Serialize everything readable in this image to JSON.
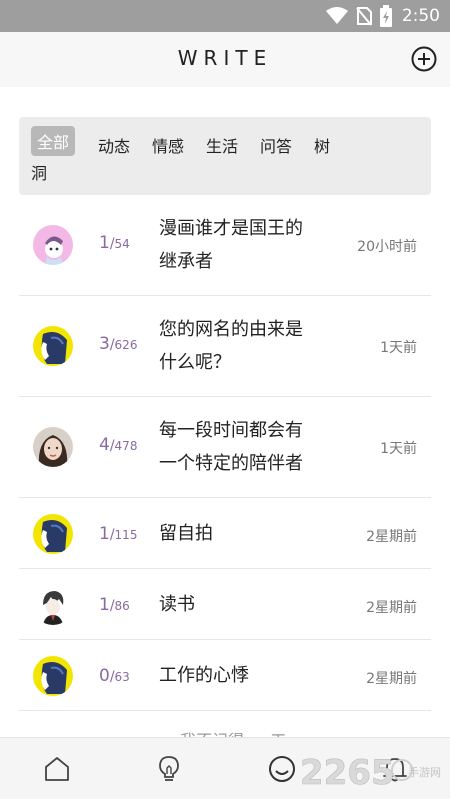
{
  "status": {
    "time": "2:50"
  },
  "header": {
    "title": "WRITE"
  },
  "tabs": [
    {
      "label": "全部",
      "active": true
    },
    {
      "label": "动态"
    },
    {
      "label": "情感"
    },
    {
      "label": "生活"
    },
    {
      "label": "问答"
    },
    {
      "label": "树"
    },
    {
      "label": "洞"
    }
  ],
  "posts": [
    {
      "count": "1",
      "sep": "/",
      "total": "54",
      "title_line1": "漫画谁才是国王的",
      "title_line2": "继承者",
      "time": "20小时前",
      "avatar": "anime-girl-pink"
    },
    {
      "count": "3",
      "sep": "/",
      "total": "626",
      "title_line1": "您的网名的由来是",
      "title_line2": "什么呢？",
      "time": "1天前",
      "avatar": "blue-hair-yellow"
    },
    {
      "count": "4",
      "sep": "/",
      "total": "478",
      "title_line1": "每一段时间都会有",
      "title_line2": "一个特定的陪伴者",
      "time": "1天前",
      "avatar": "girl-photo"
    },
    {
      "count": "1",
      "sep": "/",
      "total": "115",
      "title_line1": "留自拍",
      "time": "2星期前",
      "avatar": "blue-hair-yellow"
    },
    {
      "count": "1",
      "sep": "/",
      "total": "86",
      "title_line1": "读书",
      "time": "2星期前",
      "avatar": "anime-boy-sketch"
    },
    {
      "count": "0",
      "sep": "/",
      "total": "63",
      "title_line1": "工作的心悸",
      "time": "2星期前",
      "avatar": "blue-hair-yellow"
    }
  ],
  "partial": {
    "text": "… 我不记得 … 工"
  },
  "nav": [
    "home-icon",
    "lightbulb-icon",
    "smiley-icon",
    "bell-icon"
  ],
  "watermark": {
    "number": "2265",
    "text": "手游网"
  },
  "colors": {
    "accent": "#8a6aa0",
    "status_bar": "#9e9e9e",
    "tab_bg": "#ececec",
    "active_tab": "#b8b8b8",
    "avatar_yellow": "#f2e600"
  }
}
